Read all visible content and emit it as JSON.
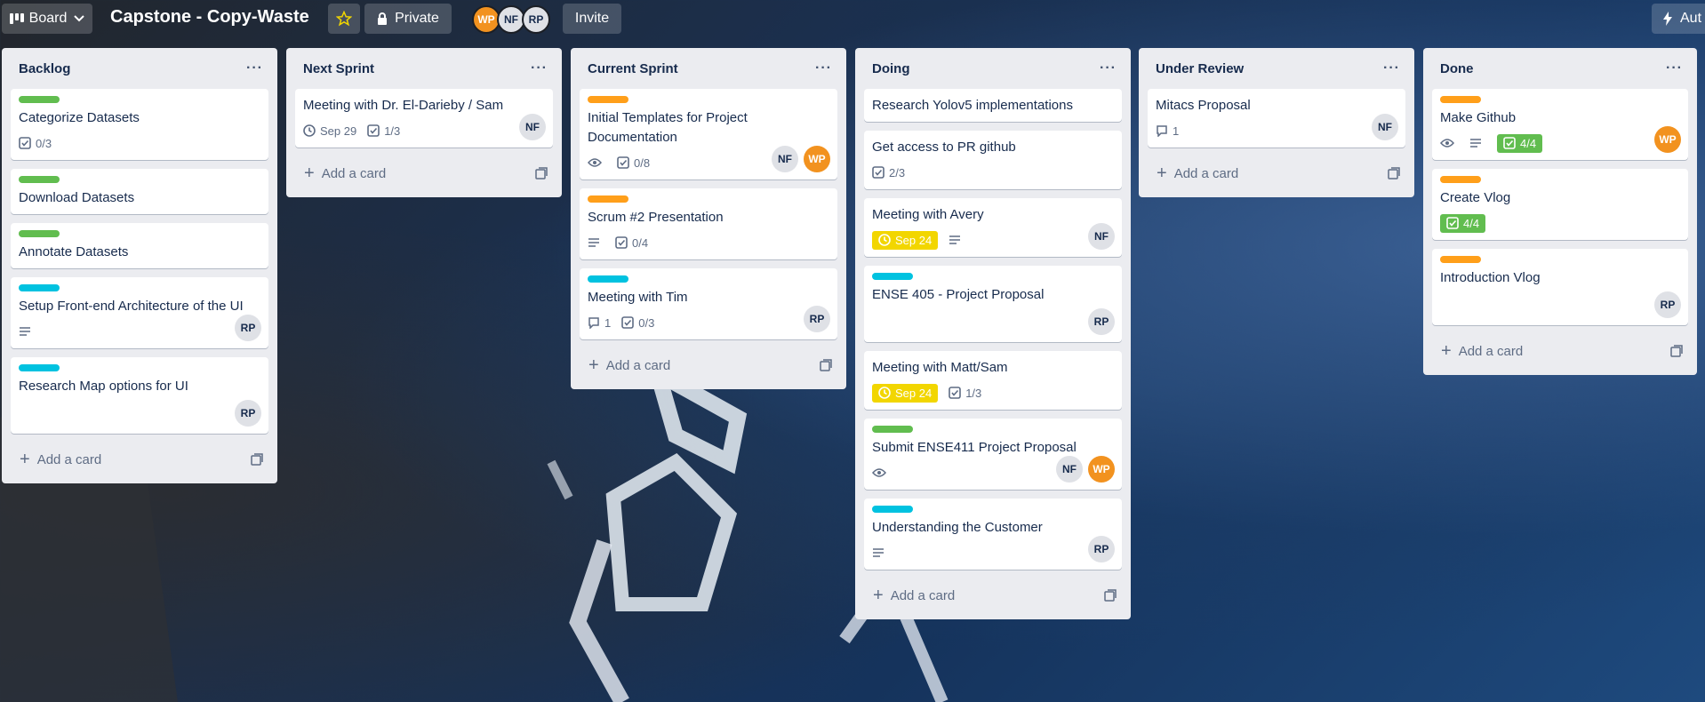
{
  "topbar": {
    "board_menu_label": "Board",
    "board_title": "Capstone - Copy-Waste",
    "visibility_label": "Private",
    "invite_label": "Invite",
    "automation_label": "Aut",
    "members": [
      "WP",
      "NF",
      "RP"
    ]
  },
  "ui": {
    "add_card_label": "Add a card"
  },
  "colors": {
    "label_green": "#61bd4f",
    "label_orange": "#ff9f1a",
    "label_sky": "#00c2e0",
    "due_yellow": "#f2d600",
    "member_orange": "#f2921f"
  },
  "lists": [
    {
      "title": "Backlog",
      "cards": [
        {
          "title": "Categorize Datasets",
          "checklist": "0/3"
        },
        {
          "title": "Download Datasets"
        },
        {
          "title": "Annotate Datasets"
        },
        {
          "title": "Setup Front-end Architecture of the UI",
          "member": "RP"
        },
        {
          "title": "Research Map options for UI",
          "member": "RP"
        }
      ]
    },
    {
      "title": "Next Sprint",
      "cards": [
        {
          "title": "Meeting with Dr. El-Darieby / Sam",
          "due": "Sep 29",
          "checklist": "1/3",
          "member": "NF"
        }
      ]
    },
    {
      "title": "Current Sprint",
      "cards": [
        {
          "title": "Initial Templates for Project Documentation",
          "checklist": "0/8",
          "members": [
            "NF",
            "WP"
          ]
        },
        {
          "title": "Scrum #2 Presentation",
          "checklist": "0/4"
        },
        {
          "title": "Meeting with Tim",
          "comments": "1",
          "checklist": "0/3",
          "member": "RP"
        }
      ]
    },
    {
      "title": "Doing",
      "cards": [
        {
          "title": "Research Yolov5 implementations"
        },
        {
          "title": "Get access to PR github",
          "checklist": "2/3"
        },
        {
          "title": "Meeting with Avery",
          "due": "Sep 24",
          "member": "NF"
        },
        {
          "title": "ENSE 405 - Project Proposal",
          "member": "RP"
        },
        {
          "title": "Meeting with Matt/Sam",
          "due": "Sep 24",
          "checklist": "1/3"
        },
        {
          "title": "Submit ENSE411 Project Proposal",
          "members": [
            "NF",
            "WP"
          ]
        },
        {
          "title": "Understanding the Customer",
          "member": "RP"
        }
      ]
    },
    {
      "title": "Under Review",
      "cards": [
        {
          "title": "Mitacs Proposal",
          "comments": "1",
          "member": "NF"
        }
      ]
    },
    {
      "title": "Done",
      "cards": [
        {
          "title": "Make Github",
          "checklist": "4/4",
          "member": "WP"
        },
        {
          "title": "Create Vlog",
          "checklist": "4/4"
        },
        {
          "title": "Introduction Vlog",
          "member": "RP"
        }
      ]
    }
  ]
}
